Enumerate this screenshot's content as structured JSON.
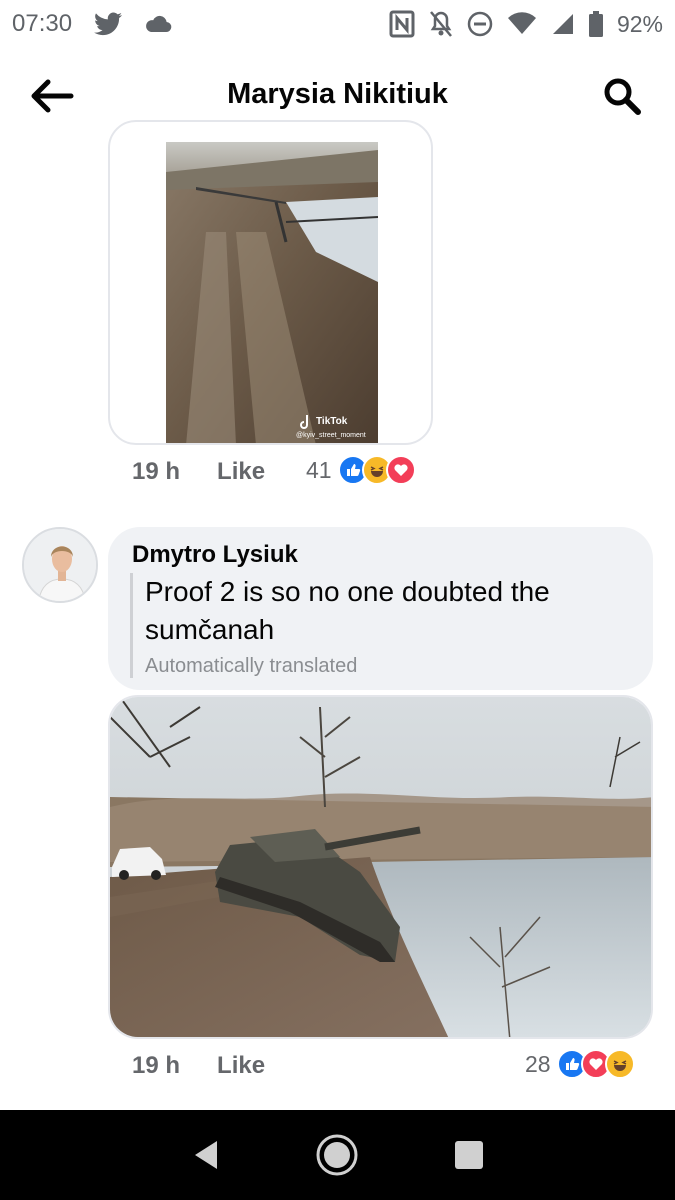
{
  "status_bar": {
    "time": "07:30",
    "battery_text": "92%",
    "icons_left": [
      "twitter-icon",
      "cloud-icon"
    ],
    "icons_right": [
      "nfc-icon",
      "notifications-off-icon",
      "do-not-disturb-icon",
      "wifi-icon",
      "signal-icon",
      "battery-icon"
    ]
  },
  "header": {
    "title": "Marysia Nikitiuk",
    "back_icon": "arrow-left-icon",
    "search_icon": "search-icon"
  },
  "comments": [
    {
      "image": {
        "type": "tiktok-video-thumbnail",
        "watermark": "TikTok",
        "watermark_handle": "@kyiv_street_moment"
      },
      "time": "19 h",
      "like_label": "Like",
      "reaction_count": "41",
      "reactions": [
        "like",
        "haha",
        "love"
      ]
    },
    {
      "author": "Dmytro Lysiuk",
      "text": "Proof 2 is so no one doubted the sumčanah",
      "translation_note": "Automatically translated",
      "image": {
        "type": "photo"
      },
      "time": "19 h",
      "like_label": "Like",
      "reaction_count": "28",
      "reactions": [
        "like",
        "love",
        "haha"
      ]
    }
  ],
  "colors": {
    "like_blue": "#1877f2",
    "haha_yellow": "#f7b928",
    "love_red": "#f33e58",
    "bubble_bg": "#f0f2f5",
    "meta_grey": "#65676b"
  },
  "nav_bar": [
    "back-triangle-icon",
    "home-circle-icon",
    "recents-square-icon"
  ]
}
